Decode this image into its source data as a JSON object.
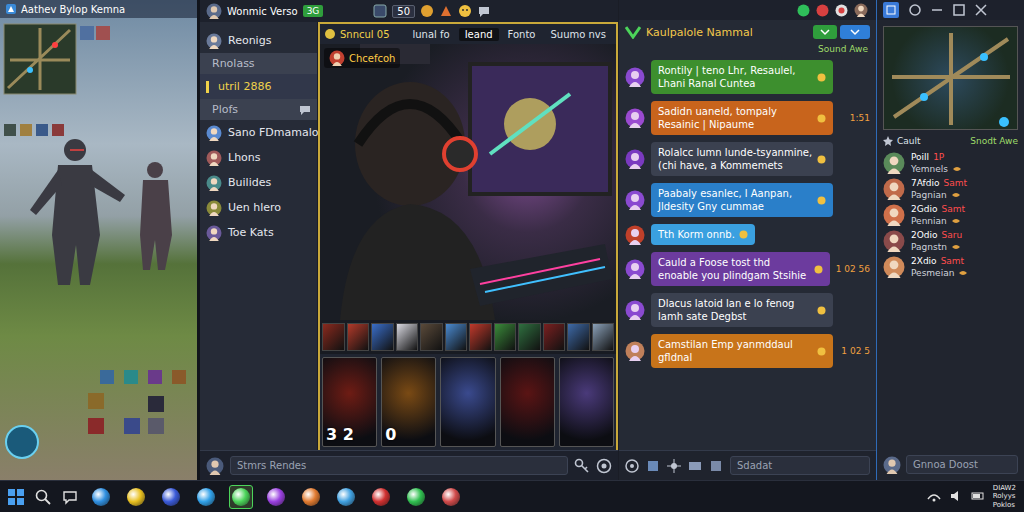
{
  "game": {
    "title": "Aathev Bylop Kemna"
  },
  "header": {
    "title": "Wonmic Verso",
    "badge": "3G",
    "count": "50"
  },
  "sidebar": {
    "items": [
      {
        "label": "Reonigs",
        "kind": "user",
        "selected": false
      },
      {
        "label": "Rnolass",
        "kind": "header",
        "selected": false
      },
      {
        "label": "utril 2886",
        "kind": "link",
        "selected": true
      },
      {
        "label": "Plofs",
        "kind": "header",
        "selected": false
      },
      {
        "label": "Sano FDmamalon",
        "kind": "user",
        "selected": false
      },
      {
        "label": "Lhons",
        "kind": "user",
        "selected": false
      },
      {
        "label": "Builides",
        "kind": "user",
        "selected": false
      },
      {
        "label": "Uen hlero",
        "kind": "user",
        "selected": false
      },
      {
        "label": "Toe Kats",
        "kind": "user",
        "selected": false
      }
    ]
  },
  "stream": {
    "channel": "Snncul 05",
    "streamer": "Chcefcoh",
    "tabs": [
      {
        "label": "lunal fo",
        "selected": false
      },
      {
        "label": "Ieand",
        "selected": true
      },
      {
        "label": "Fonto",
        "selected": false
      },
      {
        "label": "Suumo nvs",
        "selected": false
      }
    ],
    "loot": [
      {
        "color": "#8a2a1e"
      },
      {
        "color": "#b23a2a"
      },
      {
        "color": "#3a6ec9"
      },
      {
        "color": "#d8d8e0"
      },
      {
        "color": "#5a4a3a"
      },
      {
        "color": "#4a8ad0"
      },
      {
        "color": "#c0392b"
      },
      {
        "color": "#3a8a3a"
      },
      {
        "color": "#2f6f3f"
      },
      {
        "color": "#7a2020"
      },
      {
        "color": "#3e6aa8"
      },
      {
        "color": "#8aa0b8"
      }
    ],
    "cards": [
      {
        "badge": "3 2",
        "color": "#6e1c14"
      },
      {
        "badge": "0",
        "color": "#7a4a14"
      },
      {
        "badge": "",
        "color": "#3a4a8e"
      },
      {
        "badge": "",
        "color": "#5a1414"
      },
      {
        "badge": "",
        "color": "#4a3a7a"
      }
    ]
  },
  "composer": {
    "placeholder": "Stmrs Rendes"
  },
  "chat": {
    "title": "Kaulpalole Nammal",
    "subtitle": "Sound Awe",
    "messages": [
      {
        "text": "Rontily | teno Lhr, Resaulel, Lhani Ranal Cuntea",
        "time": "",
        "color": "#3d8f2e"
      },
      {
        "text": "Sadidn uaneld, tompaly Resainic | Nipaume",
        "time": "1:51",
        "color": "#c8641c"
      },
      {
        "text": "Rolalcc lumn lunde-tsyanmine, (chi have, a Kommemets",
        "time": "",
        "color": "#3b4150"
      },
      {
        "text": "Paabaly esanlec, l Aanpan, Jldesity Gny cummae",
        "time": "",
        "color": "#2a7fc9"
      },
      {
        "text": "Tth Korm onnb.",
        "time": "",
        "color": "#3aa0e0"
      },
      {
        "text": "Cauld a Foose tost thd enoable you plindgam Stsihie",
        "time": "1 02 56",
        "color": "#6c3b9e"
      },
      {
        "text": "Dlacus latoid lan e lo fenog lamh sate Degbst",
        "time": "",
        "color": "#3b4150"
      },
      {
        "text": "Camstilan Emp yanmddaul gfldnal",
        "time": "1 02 5",
        "color": "#c8741a"
      }
    ],
    "input": {
      "placeholder": "Sdadat"
    }
  },
  "side_panel": {
    "label": "Cault",
    "sublabel": "Snodt Awe",
    "users": [
      {
        "name": "Poill",
        "tag": "1P",
        "status": "Yemnels"
      },
      {
        "name": "7Afdio",
        "tag": "Samt",
        "status": "Pagnian"
      },
      {
        "name": "2Gdio",
        "tag": "Samt",
        "status": "Pennian"
      },
      {
        "name": "2Odio",
        "tag": "Saru",
        "status": "Pagnstn"
      },
      {
        "name": "2Xdio",
        "tag": "Samt",
        "status": "Pesmeian"
      }
    ],
    "input": {
      "placeholder": "Gnnoa Doost"
    }
  },
  "taskbar": {
    "apps": [
      {
        "color": "#2f8fe0",
        "selected": false
      },
      {
        "color": "#e8c020",
        "selected": false
      },
      {
        "color": "#3a5ad8",
        "selected": false
      },
      {
        "color": "#30a0e8",
        "selected": false
      },
      {
        "color": "#4cd45a",
        "selected": true
      },
      {
        "color": "#9a40e0",
        "selected": false
      },
      {
        "color": "#e07a30",
        "selected": false
      },
      {
        "color": "#40a0e0",
        "selected": false
      },
      {
        "color": "#d03030",
        "selected": false
      },
      {
        "color": "#30c050",
        "selected": false
      },
      {
        "color": "#d04a4a",
        "selected": false
      }
    ],
    "tray": [
      "DIAW2",
      "Rolyys",
      "Poklos"
    ]
  }
}
